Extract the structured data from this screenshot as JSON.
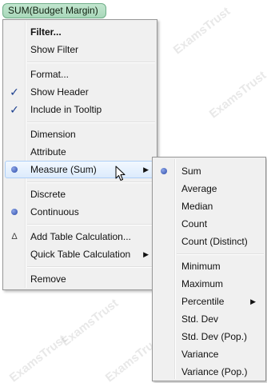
{
  "pill": {
    "label": "SUM(Budget Margin)"
  },
  "watermark": "ExamsTrust",
  "main_menu": {
    "items": [
      {
        "label": "Filter...",
        "bold": true
      },
      {
        "label": "Show Filter"
      },
      {
        "label": "Format..."
      },
      {
        "label": "Show Header",
        "checked": true
      },
      {
        "label": "Include in Tooltip",
        "checked": true
      },
      {
        "label": "Dimension"
      },
      {
        "label": "Attribute"
      },
      {
        "label": "Measure (Sum)",
        "selected": true,
        "submenu": true,
        "highlighted": true
      },
      {
        "label": "Discrete"
      },
      {
        "label": "Continuous",
        "selected": true
      },
      {
        "label": "Add Table Calculation...",
        "icon": "delta-icon"
      },
      {
        "label": "Quick Table Calculation",
        "submenu": true
      },
      {
        "label": "Remove"
      }
    ]
  },
  "sub_menu": {
    "items": [
      {
        "label": "Sum",
        "selected": true
      },
      {
        "label": "Average"
      },
      {
        "label": "Median"
      },
      {
        "label": "Count"
      },
      {
        "label": "Count (Distinct)"
      },
      {
        "label": "Minimum"
      },
      {
        "label": "Maximum"
      },
      {
        "label": "Percentile",
        "submenu": true
      },
      {
        "label": "Std. Dev"
      },
      {
        "label": "Std. Dev (Pop.)"
      },
      {
        "label": "Variance"
      },
      {
        "label": "Variance (Pop.)"
      }
    ]
  },
  "glyphs": {
    "check": "✓",
    "delta": "Δ",
    "arrow": "▶"
  }
}
